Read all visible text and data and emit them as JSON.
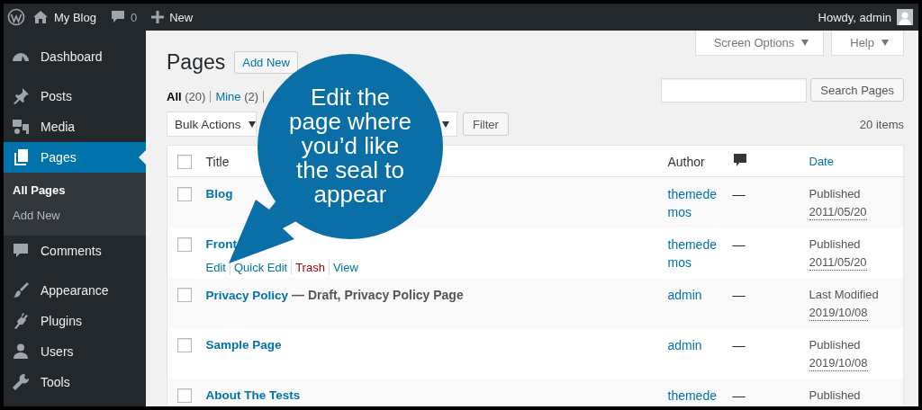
{
  "admin_bar": {
    "site_name": "My Blog",
    "comments_count": "0",
    "new_label": "New",
    "greeting": "Howdy, admin"
  },
  "sidebar": {
    "groups": [
      [
        {
          "label": "Dashboard",
          "selected": false
        }
      ],
      [
        {
          "label": "Posts",
          "selected": false
        },
        {
          "label": "Media",
          "selected": false
        },
        {
          "label": "Pages",
          "selected": true,
          "children": [
            {
              "label": "All Pages",
              "selected": true
            },
            {
              "label": "Add New",
              "selected": false
            }
          ]
        },
        {
          "label": "Comments",
          "selected": false
        }
      ],
      [
        {
          "label": "Appearance",
          "selected": false
        },
        {
          "label": "Plugins",
          "selected": false
        },
        {
          "label": "Users",
          "selected": false
        },
        {
          "label": "Tools",
          "selected": false
        }
      ]
    ]
  },
  "screen_meta": [
    "Screen Options",
    "Help"
  ],
  "page": {
    "title": "Pages",
    "add_new": "Add New"
  },
  "views": [
    {
      "label": "All",
      "count": "(20)",
      "selected": true
    },
    {
      "label": "Mine",
      "count": "(2)",
      "selected": false
    }
  ],
  "search": {
    "button": "Search Pages"
  },
  "tablenav": {
    "bulk_actions": "Bulk Actions",
    "filter": "Filter",
    "items_count": "20 items"
  },
  "table": {
    "select_all": {
      "checked": false
    },
    "columns": [
      {
        "kind": "text",
        "label": "Title",
        "link": false
      },
      {
        "kind": "text",
        "label": "Author",
        "link": false
      },
      {
        "kind": "comments"
      },
      {
        "kind": "text",
        "label": "Date",
        "link": true
      }
    ],
    "rows": [
      {
        "checked": false,
        "title": "Blog",
        "author": "themedemos",
        "comments": "—",
        "status": "Published",
        "date": "2011/05/20"
      },
      {
        "checked": false,
        "title": "Front",
        "author": "themedemos",
        "comments": "—",
        "status": "Published",
        "date": "2011/05/20",
        "actions": [
          {
            "label": "Edit",
            "kind": "link"
          },
          {
            "label": "Quick Edit",
            "kind": "link"
          },
          {
            "label": "Trash",
            "kind": "delete"
          },
          {
            "label": "View",
            "kind": "link"
          }
        ]
      },
      {
        "checked": false,
        "title": "Privacy Policy",
        "state": "— Draft, Privacy Policy Page",
        "author": "admin",
        "comments": "—",
        "status": "Last Modified",
        "date": "2019/10/08"
      },
      {
        "checked": false,
        "title": "Sample Page",
        "author": "admin",
        "comments": "—",
        "status": "Published",
        "date": "2019/10/08"
      },
      {
        "checked": false,
        "title": "About The Tests",
        "author": "themede",
        "comments": "—",
        "status": "Published"
      }
    ]
  },
  "callout": {
    "text": "Edit the\npage where\nyou’d like\nthe seal to\nappear"
  }
}
